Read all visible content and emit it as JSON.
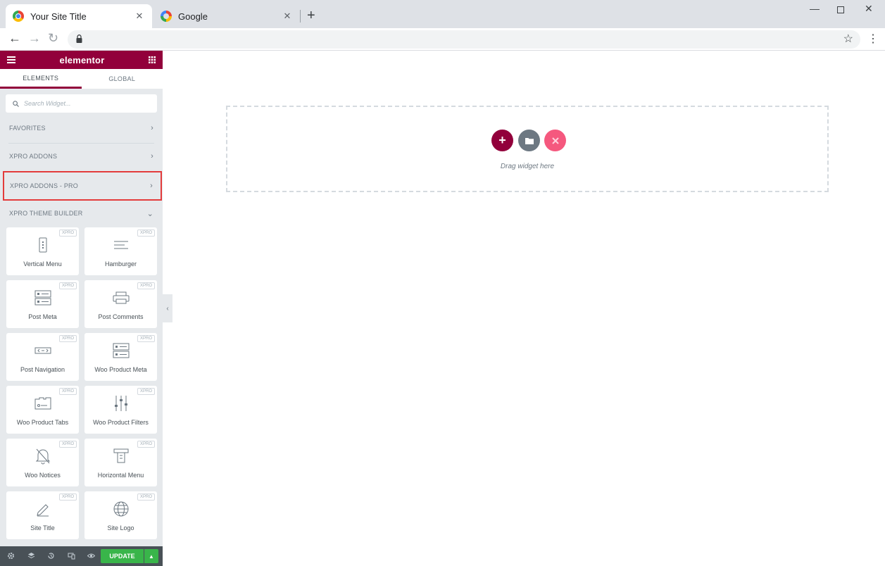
{
  "browser": {
    "tabs": [
      {
        "title": "Your Site Title",
        "active": true
      },
      {
        "title": "Google",
        "active": false
      }
    ],
    "new_tab_symbol": "+",
    "close_symbol": "✕"
  },
  "panel": {
    "logo": "elementor",
    "tabs": [
      {
        "label": "ELEMENTS",
        "active": true
      },
      {
        "label": "GLOBAL",
        "active": false
      }
    ],
    "search_placeholder": "Search Widget...",
    "categories": [
      {
        "label": "FAVORITES",
        "expanded": false
      },
      {
        "label": "XPRO ADDONS",
        "expanded": false
      },
      {
        "label": "XPRO ADDONS - PRO",
        "expanded": false,
        "highlighted": true
      },
      {
        "label": "XPRO THEME BUILDER",
        "expanded": true
      }
    ],
    "badge": "XPRO",
    "widgets": [
      {
        "label": "Vertical Menu",
        "icon": "vertical-menu-icon"
      },
      {
        "label": "Hamburger",
        "icon": "hamburger-icon"
      },
      {
        "label": "Post Meta",
        "icon": "post-meta-icon"
      },
      {
        "label": "Post Comments",
        "icon": "post-comments-icon"
      },
      {
        "label": "Post Navigation",
        "icon": "post-navigation-icon"
      },
      {
        "label": "Woo Product Meta",
        "icon": "product-meta-icon"
      },
      {
        "label": "Woo Product Tabs",
        "icon": "product-tabs-icon"
      },
      {
        "label": "Woo Product Filters",
        "icon": "filters-icon"
      },
      {
        "label": "Woo Notices",
        "icon": "notices-icon"
      },
      {
        "label": "Horizontal Menu",
        "icon": "horizontal-menu-icon"
      },
      {
        "label": "Site Title",
        "icon": "pencil-icon"
      },
      {
        "label": "Site Logo",
        "icon": "globe-icon"
      }
    ],
    "footer": {
      "update_label": "UPDATE"
    }
  },
  "canvas": {
    "drag_text": "Drag widget here"
  },
  "colors": {
    "brand": "#92003b",
    "update_green": "#39b54a",
    "highlight_red": "#e33b3b",
    "folder_gray": "#6d7882",
    "xpro_pink": "#f5587e"
  }
}
